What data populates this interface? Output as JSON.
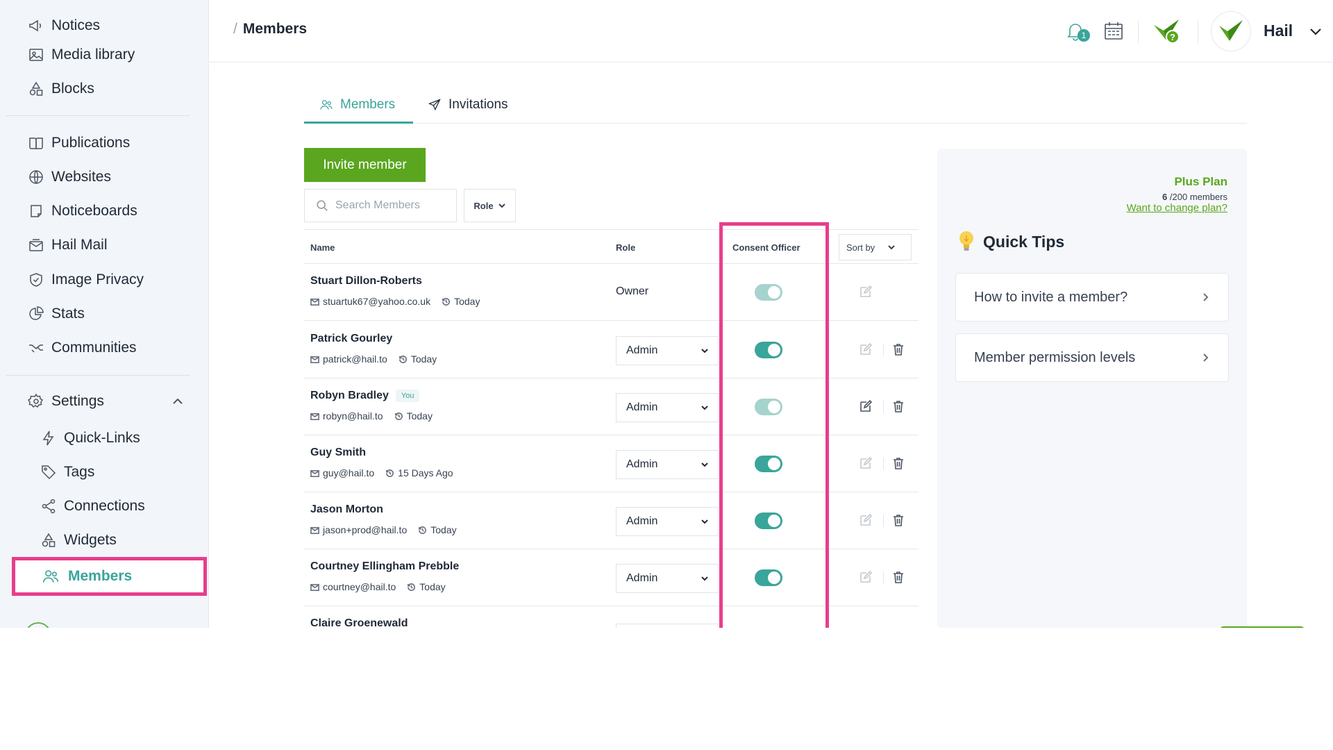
{
  "sidebar": {
    "items": [
      {
        "label": "Notices",
        "icon": "megaphone-icon"
      },
      {
        "label": "Media library",
        "icon": "image-icon"
      },
      {
        "label": "Blocks",
        "icon": "shapes-icon"
      },
      {
        "label": "Publications",
        "icon": "book-icon"
      },
      {
        "label": "Websites",
        "icon": "globe-icon"
      },
      {
        "label": "Noticeboards",
        "icon": "board-icon"
      },
      {
        "label": "Hail Mail",
        "icon": "mail-icon"
      },
      {
        "label": "Image Privacy",
        "icon": "shield-icon"
      },
      {
        "label": "Stats",
        "icon": "pie-chart-icon"
      },
      {
        "label": "Communities",
        "icon": "handshake-icon"
      }
    ],
    "settings_label": "Settings",
    "settings_items": [
      {
        "label": "Quick-Links",
        "icon": "lightning-icon"
      },
      {
        "label": "Tags",
        "icon": "tag-icon"
      },
      {
        "label": "Connections",
        "icon": "share-icon"
      },
      {
        "label": "Widgets",
        "icon": "shapes-icon"
      }
    ],
    "active_item": "Members"
  },
  "header": {
    "breadcrumb_sep": "/",
    "breadcrumb_title": "Members",
    "notification_count": "1",
    "org_name": "Hail"
  },
  "tabs": [
    {
      "label": "Members",
      "active": true
    },
    {
      "label": "Invitations",
      "active": false
    }
  ],
  "controls": {
    "invite_label": "Invite member",
    "search_placeholder": "Search Members",
    "role_filter_label": "Role"
  },
  "table": {
    "columns": {
      "name": "Name",
      "role": "Role",
      "consent": "Consent Officer",
      "sort": "Sort by"
    },
    "rows": [
      {
        "name": "Stuart Dillon-Roberts",
        "email": "stuartuk67@yahoo.co.uk",
        "time": "Today",
        "role": "Owner",
        "consent": true,
        "toggle_disabled": true
      },
      {
        "name": "Patrick Gourley",
        "email": "patrick@hail.to",
        "time": "Today",
        "role": "Admin",
        "consent": true,
        "toggle_disabled": false
      },
      {
        "name": "Robyn Bradley",
        "badge": "You",
        "email": "robyn@hail.to",
        "time": "Today",
        "role": "Admin",
        "consent": true,
        "toggle_disabled": true
      },
      {
        "name": "Guy Smith",
        "email": "guy@hail.to",
        "time": "15 Days Ago",
        "role": "Admin",
        "consent": true,
        "toggle_disabled": false
      },
      {
        "name": "Jason Morton",
        "email": "jason+prod@hail.to",
        "time": "Today",
        "role": "Admin",
        "consent": true,
        "toggle_disabled": false
      },
      {
        "name": "Courtney Ellingham Prebble",
        "email": "courtney@hail.to",
        "time": "Today",
        "role": "Admin",
        "consent": true,
        "toggle_disabled": false
      },
      {
        "name": "Claire Groenewald"
      }
    ]
  },
  "panel": {
    "plan_name": "Plus Plan",
    "plan_count": "6",
    "plan_limit": "/200 members",
    "plan_link": "Want to change plan?",
    "tips_title": "Quick Tips",
    "tips": [
      "How to invite a member?",
      "Member permission levels"
    ]
  },
  "colors": {
    "accent_teal": "#3aa59a",
    "brand_green": "#5aa61f",
    "highlight_pink": "#e83e8c"
  }
}
